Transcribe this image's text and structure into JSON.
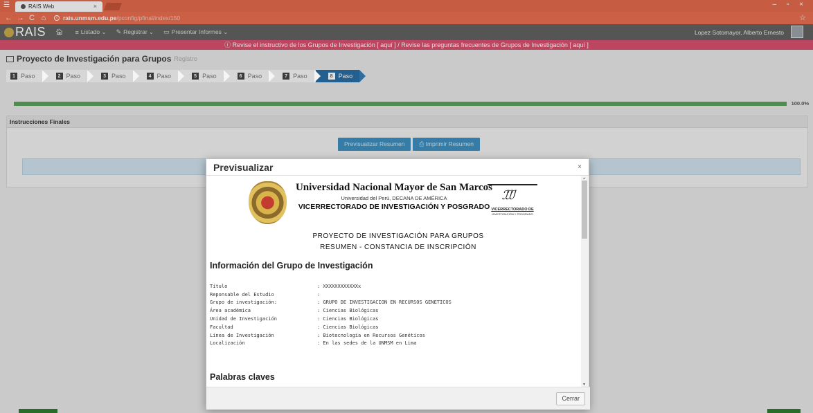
{
  "browser": {
    "tab_title": "RAIS Web",
    "tab_close": "×",
    "url_host": "rais.unmsm.edu.pe",
    "url_path": "/pconfig/pfinal/index/150",
    "window_controls": "– ▫ ×"
  },
  "navbar": {
    "brand": "RAIS",
    "items": [
      {
        "icon": "home-icon",
        "label": ""
      },
      {
        "icon": "list-icon",
        "label": "Listado ⌄"
      },
      {
        "icon": "pencil-icon",
        "label": "Registrar ⌄"
      },
      {
        "icon": "document-icon",
        "label": "Presentar Informes ⌄"
      }
    ],
    "user": "Lopez Sotomayor, Alberto Ernesto"
  },
  "alert": "Revise el instructivo de los Grupos de Investigación [ aquí ] / Revise las preguntas frecuentes de Grupos de Investigación [ aquí ]",
  "page": {
    "title": "Proyecto de Investigación para Grupos",
    "subtitle": "Registro"
  },
  "steps": [
    {
      "num": "1",
      "label": "Paso"
    },
    {
      "num": "2",
      "label": "Paso"
    },
    {
      "num": "3",
      "label": "Paso"
    },
    {
      "num": "4",
      "label": "Paso"
    },
    {
      "num": "5",
      "label": "Paso"
    },
    {
      "num": "6",
      "label": "Paso"
    },
    {
      "num": "7",
      "label": "Paso"
    },
    {
      "num": "8",
      "label": "Paso"
    }
  ],
  "progress": {
    "value": 1.0,
    "label": "100.0%"
  },
  "panel": {
    "header": "Instrucciones Finales",
    "preview_button": "Previsualizar Resumen",
    "print_button": "Imprimir Resumen"
  },
  "modal": {
    "title": "Previsualizar",
    "close": "×",
    "university": "Universidad Nacional Mayor de San Marcos",
    "university_sub": "Universidad del Perú, DECANA DE AMÉRICA",
    "vicerrectorado": "VICERRECTORADO DE INVESTIGACIÓN Y POSGRADO",
    "logo_text_1": "VICERRECTORADO DE",
    "logo_text_2": "INVESTIGACIÓN Y POSGRADO",
    "doc_title": "PROYECTO DE INVESTIGACIÓN PARA GRUPOS",
    "doc_subtitle": "RESUMEN - CONSTANCIA DE INSCRIPCIÓN",
    "section_info": "Información del Grupo de Investigación",
    "rows": [
      {
        "key": "Título",
        "value": ": XXXXXXXXXXXXx"
      },
      {
        "key": "Reponsable del Estudio",
        "value": ":"
      },
      {
        "key": "Grupo de investigación:",
        "value": ": GRUPO DE INVESTIGACION EN RECURSOS GENETICOS"
      },
      {
        "key": "Área académica",
        "value": ": Ciencias Biológicas"
      },
      {
        "key": "Unidad de Investigación",
        "value": ": Ciencias Biológicas"
      },
      {
        "key": "Facultad",
        "value": ": Ciencias Biológicas"
      },
      {
        "key": "Línea de Investigación",
        "value": ": Biotecnología en Recursos Genéticos"
      },
      {
        "key": "Localización",
        "value": ": En las sedes de la UNMSM en Lima"
      }
    ],
    "section_keywords": "Palabras claves",
    "close_button": "Cerrar"
  }
}
